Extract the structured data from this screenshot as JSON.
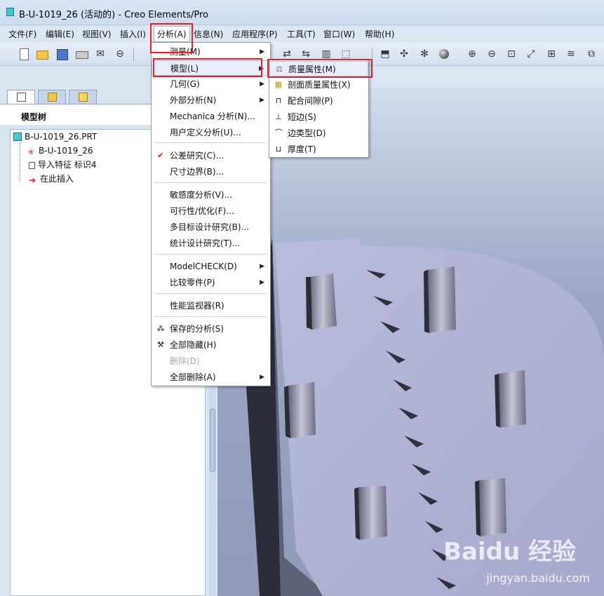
{
  "window": {
    "title": "B-U-1019_26 (活动的) - Creo Elements/Pro"
  },
  "menubar": {
    "items": [
      "文件(F)",
      "编辑(E)",
      "视图(V)",
      "插入(I)",
      "分析(A)",
      "信息(N)",
      "应用程序(P)",
      "工具(T)",
      "窗口(W)",
      "帮助(H)"
    ],
    "active": "分析(A)"
  },
  "panel": {
    "tree_title": "模型树"
  },
  "tree": {
    "root": "B-U-1019_26.PRT",
    "children": [
      "B-U-1019_26",
      "导入特征 标识4",
      "在此插入"
    ]
  },
  "analysis_menu": {
    "items": [
      "测量(M)",
      "模型(L)",
      "几何(G)",
      "外部分析(N)",
      "Mechanica 分析(N)...",
      "用户定义分析(U)...",
      "公差研究(C)...",
      "尺寸边界(B)...",
      "敏感度分析(V)...",
      "可行性/优化(F)...",
      "多目标设计研究(B)...",
      "统计设计研究(T)...",
      "ModelCHECK(D)",
      "比较零件(P)",
      "性能监视器(R)",
      "保存的分析(S)",
      "全部隐藏(H)",
      "删除(D)",
      "全部删除(A)"
    ]
  },
  "model_submenu": {
    "items": [
      "质量属性(M)",
      "剖面质量属性(X)",
      "配合间隙(P)",
      "短边(S)",
      "边类型(D)",
      "厚度(T)"
    ]
  },
  "watermark": {
    "brand": "Baidu 经验",
    "url": "jingyan.baidu.com"
  },
  "colors": {
    "highlight_box": "#e1222b",
    "model_plate": "#b3b6d6",
    "model_tabs": "#8e92ad"
  }
}
